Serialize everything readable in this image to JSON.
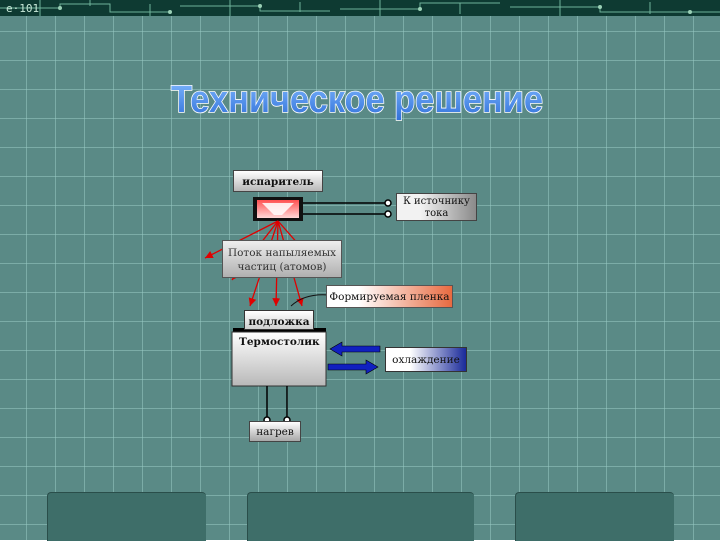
{
  "slide": {
    "title": "Техническое решение",
    "colors": {
      "background": "#5a8a86",
      "title_fill": "#3e7fe0",
      "flux_lines": "#e00000",
      "cooling_arrow": "#1020c0"
    }
  },
  "diagram": {
    "evaporator": {
      "label": "испаритель"
    },
    "power_source": {
      "label_line1": "К источнику",
      "label_line2": "тока"
    },
    "particle_flux": {
      "label_line1": "Поток напыляемых",
      "label_line2": "частиц (атомов)"
    },
    "film": {
      "label": "Формируемая пленка"
    },
    "substrate": {
      "label": "подложка"
    },
    "heater_table": {
      "label": "Термостолик"
    },
    "cooling": {
      "label": "охлаждение"
    },
    "heating": {
      "label": "нагрев"
    }
  },
  "nav_buttons": [
    {
      "icon": "blank-button"
    },
    {
      "icon": "blank-button"
    },
    {
      "icon": "blank-button"
    }
  ]
}
